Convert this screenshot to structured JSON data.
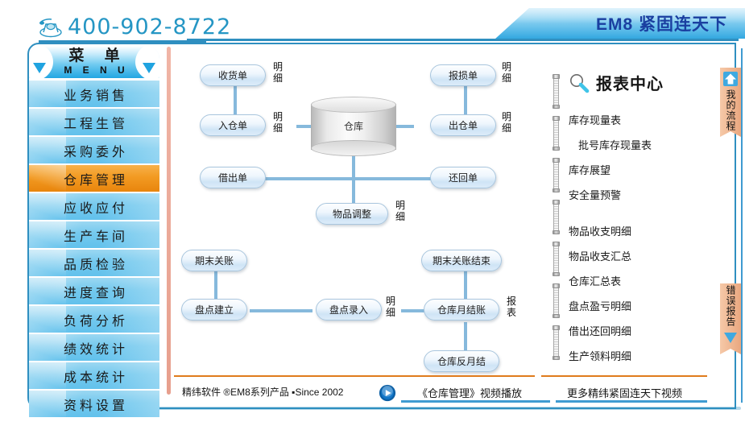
{
  "header": {
    "phone_icon": "telephone-icon",
    "phone": "400-902-8722",
    "banner_title": "EM8 紧固连天下"
  },
  "sidebar": {
    "header_cn": "菜 单",
    "header_en": "M E N U",
    "items": [
      {
        "label": "业务销售",
        "active": false
      },
      {
        "label": "工程生管",
        "active": false
      },
      {
        "label": "采购委外",
        "active": false
      },
      {
        "label": "仓库管理",
        "active": true
      },
      {
        "label": "应收应付",
        "active": false
      },
      {
        "label": "生产车间",
        "active": false
      },
      {
        "label": "品质检验",
        "active": false
      },
      {
        "label": "进度查询",
        "active": false
      },
      {
        "label": "负荷分析",
        "active": false
      },
      {
        "label": "绩效统计",
        "active": false
      },
      {
        "label": "成本统计",
        "active": false
      },
      {
        "label": "资料设置",
        "active": false
      }
    ],
    "active_color": "#f29a22",
    "item_color": "#74c9ee"
  },
  "flow": {
    "center": {
      "label": "仓库",
      "icon": "database-cylinder-icon"
    },
    "nodes": [
      {
        "id": "shou-huo-dan",
        "label": "收货单",
        "detail": "明细"
      },
      {
        "id": "ru-cang-dan",
        "label": "入仓单",
        "detail": "明细"
      },
      {
        "id": "bao-sun-dan",
        "label": "报损单",
        "detail": "明细"
      },
      {
        "id": "chu-cang-dan",
        "label": "出仓单",
        "detail": "明细"
      },
      {
        "id": "jie-chu-dan",
        "label": "借出单",
        "detail": ""
      },
      {
        "id": "huan-hui-dan",
        "label": "还回单",
        "detail": ""
      },
      {
        "id": "wu-pin-tiao-zheng",
        "label": "物品调整",
        "detail": "明细"
      },
      {
        "id": "qi-mo-guan-zhang",
        "label": "期末关账",
        "detail": ""
      },
      {
        "id": "qi-mo-guan-zhang-jie-shu",
        "label": "期末关账结束",
        "detail": ""
      },
      {
        "id": "pan-dian-jian-li",
        "label": "盘点建立",
        "detail": ""
      },
      {
        "id": "pan-dian-lu-ru",
        "label": "盘点录入",
        "detail": "明细"
      },
      {
        "id": "cang-ku-yue-jie-zhang",
        "label": "仓库月结账",
        "detail": "报表"
      },
      {
        "id": "cang-ku-fan-yue-jie",
        "label": "仓库反月结",
        "detail": ""
      }
    ],
    "connector_color": "#86b9dc"
  },
  "reports": {
    "icon": "magnifier-icon",
    "title": "报表中心",
    "group1": [
      "库存现量表",
      "批号库存现量表",
      "库存展望",
      "安全量预警"
    ],
    "group2": [
      "物品收支明细",
      "物品收支汇总",
      "仓库汇总表",
      "盘点盈亏明细",
      "借出还回明细",
      "生产领料明细"
    ]
  },
  "right_tabs": [
    {
      "id": "my-flow",
      "label": "我的流程",
      "icon": "home-up-arrow-icon"
    },
    {
      "id": "error-report",
      "label": "错误报告",
      "icon": "down-arrow-icon"
    }
  ],
  "footer": {
    "copyright": "精纬软件 ®EM8系列产品 ▪Since 2002",
    "play_icon": "play-button-icon",
    "video_link": "《仓库管理》视频播放",
    "more_link": "更多精纬紧固连天下视频"
  },
  "colors": {
    "accent_blue": "#2f8fc0",
    "orange": "#e07b1c",
    "salmon": "#e79f8d",
    "banner_text": "#1a3fa0"
  }
}
